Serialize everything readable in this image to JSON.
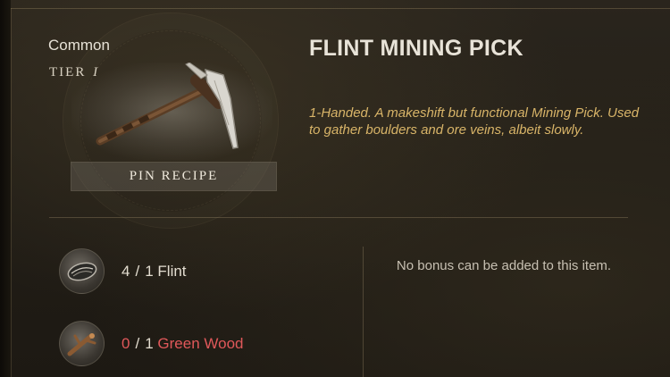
{
  "item": {
    "rarity": "Common",
    "tier_label": "TIER",
    "tier_value": "I",
    "name": "FLINT MINING PICK",
    "description": "1-Handed. A makeshift but functional Mining Pick. Used to gather boulders and ore veins, albeit slowly.",
    "pin_button_label": "PIN RECIPE"
  },
  "ingredients": [
    {
      "have": "4",
      "sep": "/",
      "need": "1",
      "name": "Flint",
      "icon": "flint-icon",
      "sufficient": true
    },
    {
      "have": "0",
      "sep": "/",
      "need": "1",
      "name": "Green Wood",
      "icon": "green-wood-icon",
      "sufficient": false
    }
  ],
  "bonus_text": "No bonus can be added to this item.",
  "colors": {
    "description": "#d8b468",
    "insufficient": "#e0585a",
    "text": "#e3ddd0"
  }
}
